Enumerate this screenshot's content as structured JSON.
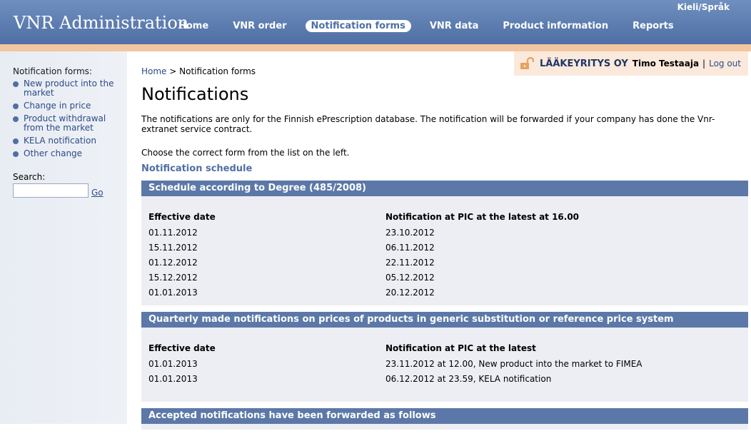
{
  "header": {
    "app_title": "VNR Administration",
    "language_link": "Kieli/Språk",
    "nav": [
      {
        "label": "Home",
        "active": false
      },
      {
        "label": "VNR order",
        "active": false
      },
      {
        "label": "Notification forms",
        "active": true
      },
      {
        "label": "VNR data",
        "active": false
      },
      {
        "label": "Product information",
        "active": false
      },
      {
        "label": "Reports",
        "active": false
      }
    ]
  },
  "user": {
    "company": "LÄÄKEYRITYS OY",
    "name": "Timo Testaaja",
    "separator": "|",
    "logout": "Log out"
  },
  "sidebar": {
    "heading": "Notification forms:",
    "items": [
      {
        "label": "New product into the market"
      },
      {
        "label": "Change in price"
      },
      {
        "label": "Product withdrawal from the market"
      },
      {
        "label": "KELA notification"
      },
      {
        "label": "Other change"
      }
    ],
    "search_label": "Search:",
    "search_value": "",
    "go_label": "Go"
  },
  "main": {
    "breadcrumb": {
      "home": "Home",
      "separator": ">",
      "current": "Notification forms"
    },
    "title": "Notifications",
    "intro": "The notifications are only for the Finnish ePrescription database. The notification will be forwarded if your company has done the Vnr-extranet service contract.",
    "choose": "Choose the correct form from the list on the left.",
    "schedule_heading": "Notification schedule",
    "panels": [
      {
        "title": "Schedule according to Degree (485/2008)",
        "headers": [
          "Effective date",
          "Notification at PIC at the latest at 16.00"
        ],
        "rows": [
          [
            "01.11.2012",
            "23.10.2012"
          ],
          [
            "15.11.2012",
            "06.11.2012"
          ],
          [
            "01.12.2012",
            "22.11.2012"
          ],
          [
            "15.12.2012",
            "05.12.2012"
          ],
          [
            "01.01.2013",
            "20.12.2012"
          ]
        ]
      },
      {
        "title": "Quarterly made notifications on prices of products in generic substitution or reference price system",
        "headers": [
          "Effective date",
          "Notification at PIC at the latest"
        ],
        "rows": [
          [
            "01.01.2013",
            "23.11.2012 at 12.00, New product into the market to FIMEA"
          ],
          [
            "01.01.2013",
            "06.12.2012 at 23.59, KELA notification"
          ]
        ]
      },
      {
        "title": "Accepted notifications have been forwarded as follows"
      }
    ]
  },
  "colors": {
    "header_blue": "#4f6fa5",
    "panel_header": "#5b78a8",
    "accent_bar": "#f2c6a0",
    "link_blue": "#2c4b88"
  }
}
